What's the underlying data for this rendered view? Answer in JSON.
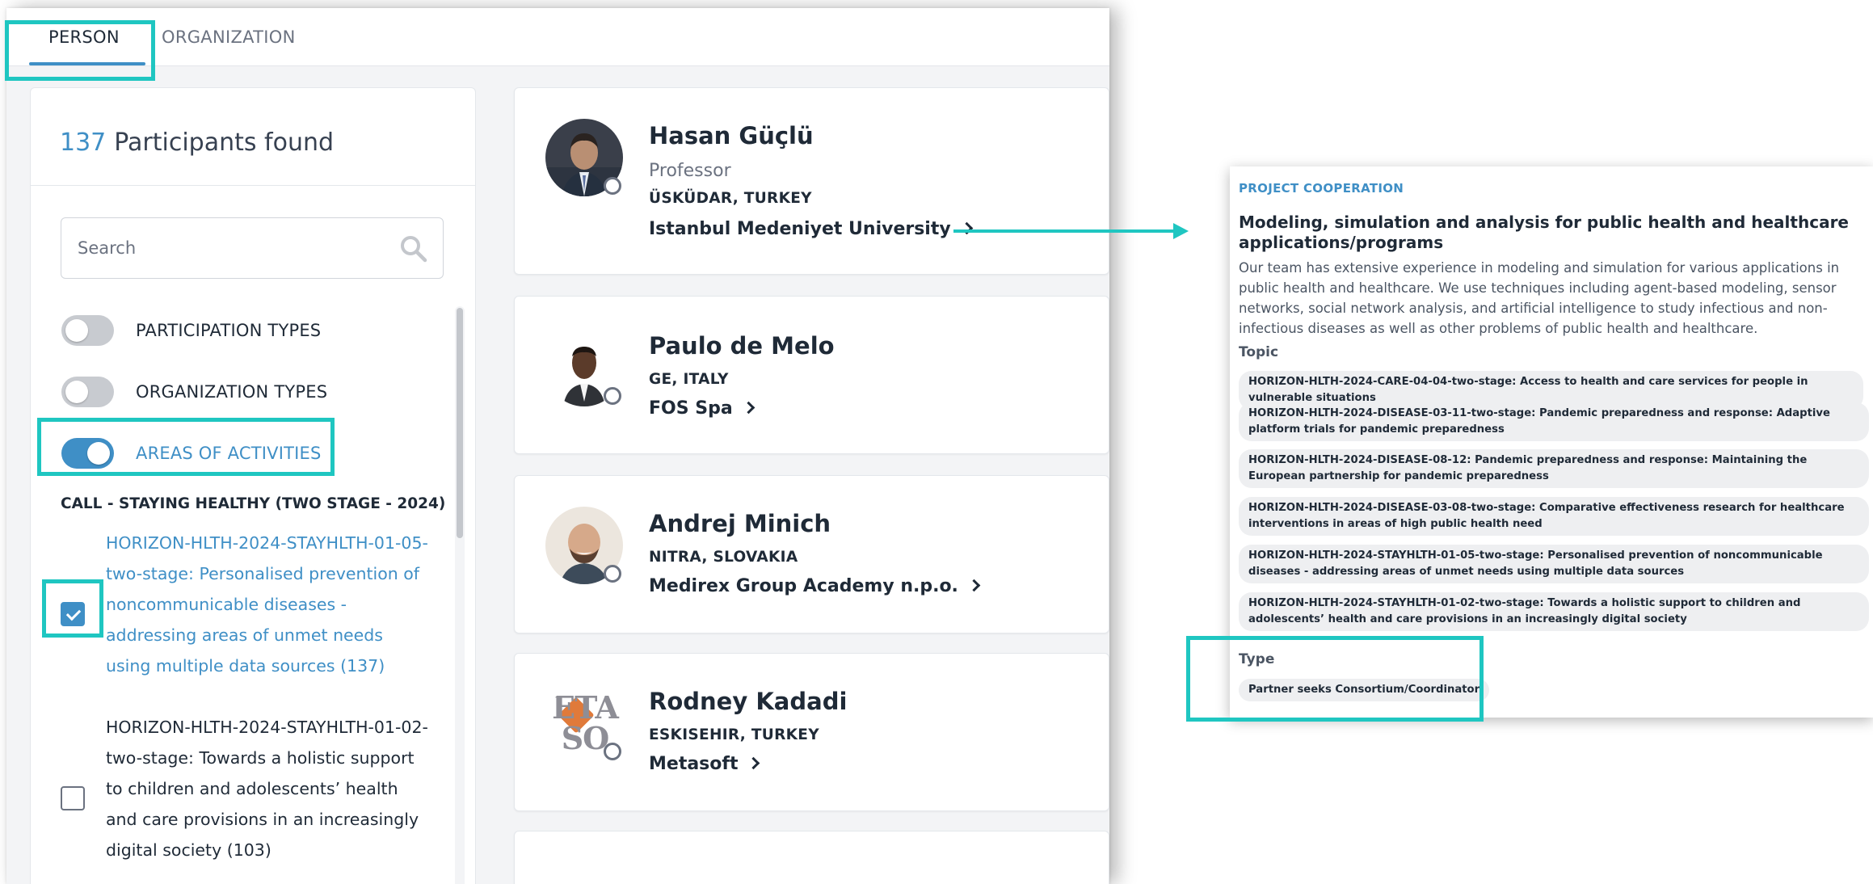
{
  "tabs": [
    {
      "label": "PERSON",
      "active": true
    },
    {
      "label": "ORGANIZATION",
      "active": false
    }
  ],
  "sidebar": {
    "count": "137",
    "found_label": "Participants found",
    "search_placeholder": "Search",
    "filters": [
      {
        "label": "PARTICIPATION TYPES",
        "enabled": false
      },
      {
        "label": "ORGANIZATION TYPES",
        "enabled": false
      },
      {
        "label": "AREAS OF ACTIVITIES",
        "enabled": true
      }
    ],
    "call_heading": "CALL - STAYING HEALTHY (TWO STAGE - 2024)",
    "topics": [
      {
        "label": "HORIZON-HLTH-2024-STAYHLTH-01-05-two-stage: Personalised prevention of noncommunicable diseases - addressing areas of unmet needs using multiple data sources (137)",
        "checked": true
      },
      {
        "label": "HORIZON-HLTH-2024-STAYHLTH-01-02-two-stage: Towards a holistic support to children and adolescents’ health and care provisions in an increasingly digital society (103)",
        "checked": false
      }
    ]
  },
  "people": [
    {
      "name": "Hasan Güçlü",
      "role": "Professor",
      "location": "ÜSKÜDAR, TURKEY",
      "organization": "Istanbul Medeniyet University"
    },
    {
      "name": "Paulo de Melo",
      "role": "",
      "location": "GE, ITALY",
      "organization": "FOS Spa"
    },
    {
      "name": "Andrej Minich",
      "role": "",
      "location": "NITRA, SLOVAKIA",
      "organization": "Medirex Group Academy n.p.o."
    },
    {
      "name": "Rodney Kadadi",
      "role": "",
      "location": "ESKISEHIR, TURKEY",
      "organization": "Metasoft",
      "avatar_text": "ETA SO"
    }
  ],
  "detail": {
    "type": "PROJECT COOPERATION",
    "title": "Modeling, simulation and analysis for public health and healthcare applications/programs",
    "description": "Our team has extensive experience in modeling and simulation for various applications in public health and healthcare. We use techniques including agent-based modeling, sensor networks, social network analysis, and artificial intelligence to study infectious and non-infectious diseases as well as other problems of public health and healthcare.",
    "topic_label": "Topic",
    "topics": [
      "HORIZON-HLTH-2024-CARE-04-04-two-stage: Access to health and care services for people in vulnerable situations",
      "HORIZON-HLTH-2024-DISEASE-03-11-two-stage: Pandemic preparedness and response: Adaptive platform trials for pandemic preparedness",
      "HORIZON-HLTH-2024-DISEASE-08-12: Pandemic preparedness and response: Maintaining the European partnership for pandemic preparedness",
      "HORIZON-HLTH-2024-DISEASE-03-08-two-stage: Comparative effectiveness research for healthcare interventions in areas of high public health need",
      "HORIZON-HLTH-2024-STAYHLTH-01-05-two-stage: Personalised prevention of noncommunicable diseases - addressing areas of unmet needs using multiple data sources",
      "HORIZON-HLTH-2024-STAYHLTH-01-02-two-stage: Towards a holistic support to children and adolescents’ health and care provisions in an increasingly digital society"
    ],
    "type_label": "Type",
    "type_value": "Partner seeks Consortium/Coordinator"
  },
  "colors": {
    "accent": "#3f8fc6",
    "highlight": "#1fc6c1"
  }
}
